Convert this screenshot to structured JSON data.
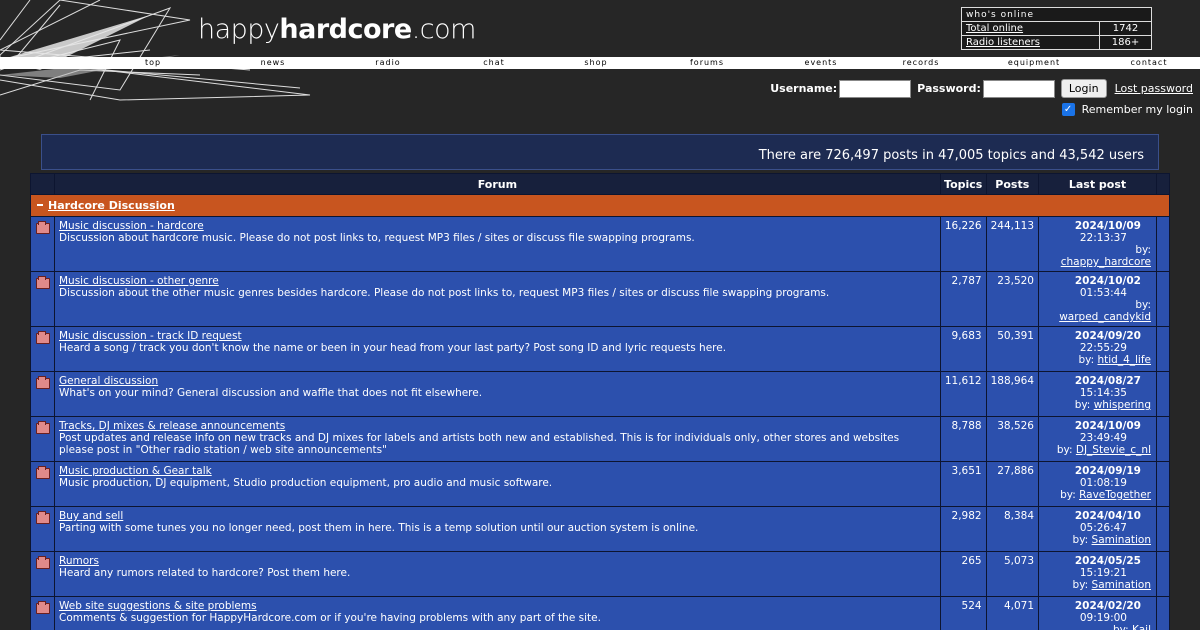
{
  "brand": {
    "light": "happy",
    "bold": "hardcore",
    "suffix": ".com"
  },
  "online": {
    "title": "who's online",
    "rows": [
      {
        "label": "Total online",
        "value": "1742"
      },
      {
        "label": "Radio listeners",
        "value": "186+"
      }
    ]
  },
  "nav": [
    "top",
    "news",
    "radio",
    "chat",
    "shop",
    "forums",
    "events",
    "records",
    "equipment",
    "contact"
  ],
  "login": {
    "username_label": "Username:",
    "password_label": "Password:",
    "button": "Login",
    "lost": "Lost password",
    "remember": "Remember my login"
  },
  "stats": "There are 726,497 posts in 47,005 topics and 43,542 users",
  "table": {
    "headers": {
      "forum": "Forum",
      "topics": "Topics",
      "posts": "Posts",
      "last": "Last post"
    },
    "category": "Hardcore Discussion",
    "rows": [
      {
        "title": "Music discussion - hardcore",
        "desc": "Discussion about hardcore music. Please do not post links to, request MP3 files / sites or discuss file swapping programs.",
        "topics": "16,226",
        "posts": "244,113",
        "date": "2024/10/09",
        "time": "22:13:37",
        "user": "chappy_hardcore"
      },
      {
        "title": "Music discussion - other genre",
        "desc": "Discussion about the other music genres besides hardcore. Please do not post links to, request MP3 files / sites or discuss file swapping programs.",
        "topics": "2,787",
        "posts": "23,520",
        "date": "2024/10/02",
        "time": "01:53:44",
        "user": "warped_candykid"
      },
      {
        "title": "Music discussion - track ID request",
        "desc": "Heard a song / track you don't know the name or been in your head from your last party? Post song ID and lyric requests here.",
        "topics": "9,683",
        "posts": "50,391",
        "date": "2024/09/20",
        "time": "22:55:29",
        "user": "htid_4_life"
      },
      {
        "title": "General discussion",
        "desc": "What's on your mind? General discussion and waffle that does not fit elsewhere.",
        "topics": "11,612",
        "posts": "188,964",
        "date": "2024/08/27",
        "time": "15:14:35",
        "user": "whispering"
      },
      {
        "title": "Tracks, DJ mixes & release announcements",
        "desc": "Post updates and release info on new tracks and DJ mixes for labels and artists both new and established. This is for individuals only, other stores and websites please post in \"Other radio station / web site announcements\"",
        "topics": "8,788",
        "posts": "38,526",
        "date": "2024/10/09",
        "time": "23:49:49",
        "user": "DJ_Stevie_c_nl"
      },
      {
        "title": "Music production & Gear talk",
        "desc": "Music production, DJ equipment, Studio production equipment, pro audio and music software.",
        "topics": "3,651",
        "posts": "27,886",
        "date": "2024/09/19",
        "time": "01:08:19",
        "user": "RaveTogether"
      },
      {
        "title": "Buy and sell",
        "desc": "Parting with some tunes you no longer need, post them in here. This is a temp solution until our auction system is online.",
        "topics": "2,982",
        "posts": "8,384",
        "date": "2024/04/10",
        "time": "05:26:47",
        "user": "Samination"
      },
      {
        "title": "Rumors",
        "desc": "Heard any rumors related to hardcore? Post them here.",
        "topics": "265",
        "posts": "5,073",
        "date": "2024/05/25",
        "time": "15:19:21",
        "user": "Samination"
      },
      {
        "title": "Web site suggestions & site problems",
        "desc": "Comments & suggestion for HappyHardcore.com or if you're having problems with any part of the site.",
        "topics": "524",
        "posts": "4,071",
        "date": "2024/02/20",
        "time": "09:19:00",
        "user": "Kail"
      }
    ]
  }
}
